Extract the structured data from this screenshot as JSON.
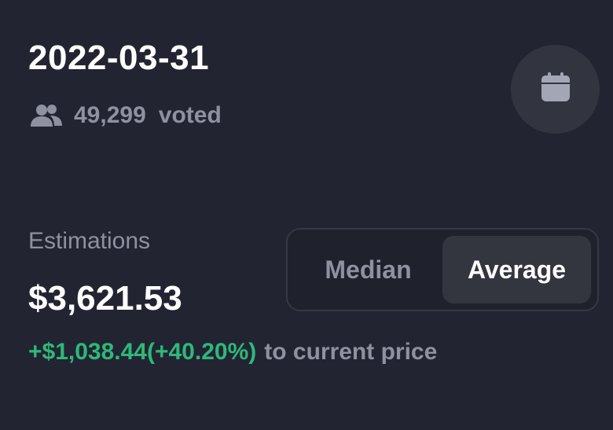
{
  "header": {
    "date": "2022-03-31",
    "voted_count": "49,299",
    "voted_label": "voted",
    "users_icon": "users-icon",
    "calendar_icon": "calendar-icon"
  },
  "estimations": {
    "label": "Estimations",
    "value": "$3,621.53",
    "change": "+$1,038.44(+40.20%)",
    "change_suffix": "to current price",
    "change_color": "#2eb87a"
  },
  "toggle": {
    "options": [
      {
        "label": "Median",
        "active": false
      },
      {
        "label": "Average",
        "active": true
      }
    ]
  }
}
